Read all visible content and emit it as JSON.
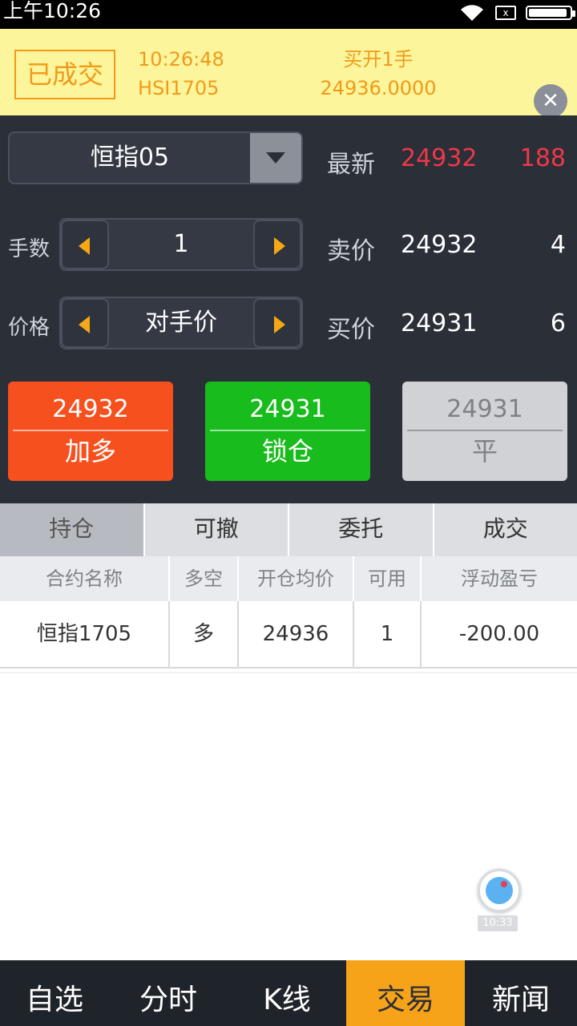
{
  "status_bar": {
    "time": "上午10:26",
    "sim_icon": "x",
    "battery_level": 0.95
  },
  "notice": {
    "badge": "已成交",
    "time": "10:26:48",
    "symbol": "HSI1705",
    "action": "买开1手",
    "price": "24936.0000"
  },
  "contract_select": {
    "label": "恒指05"
  },
  "quote": {
    "latest_label": "最新",
    "latest_price": "24932",
    "latest_change": "188",
    "ask_label": "卖价",
    "ask_price": "24932",
    "ask_qty": "4",
    "bid_label": "买价",
    "bid_price": "24931",
    "bid_qty": "6"
  },
  "order": {
    "qty_label": "手数",
    "qty_value": "1",
    "price_label": "价格",
    "price_value": "对手价"
  },
  "actions": {
    "buy_price": "24932",
    "buy_label": "加多",
    "lock_price": "24931",
    "lock_label": "锁仓",
    "close_price": "24931",
    "close_label": "平"
  },
  "tabs": [
    "持仓",
    "可撤",
    "委托",
    "成交"
  ],
  "table": {
    "headers": [
      "合约名称",
      "多空",
      "开仓均价",
      "可用",
      "浮动盈亏"
    ],
    "rows": [
      [
        "恒指1705",
        "多",
        "24936",
        "1",
        "-200.00"
      ]
    ]
  },
  "float_recorder": {
    "time": "10:33"
  },
  "bottom_nav": [
    "自选",
    "分时",
    "K线",
    "交易",
    "新闻"
  ],
  "colors": {
    "accent": "#f6a31a",
    "buy": "#f5501e",
    "lock": "#18bc1c",
    "up": "#f0374a",
    "banner": "#fdf59b"
  }
}
